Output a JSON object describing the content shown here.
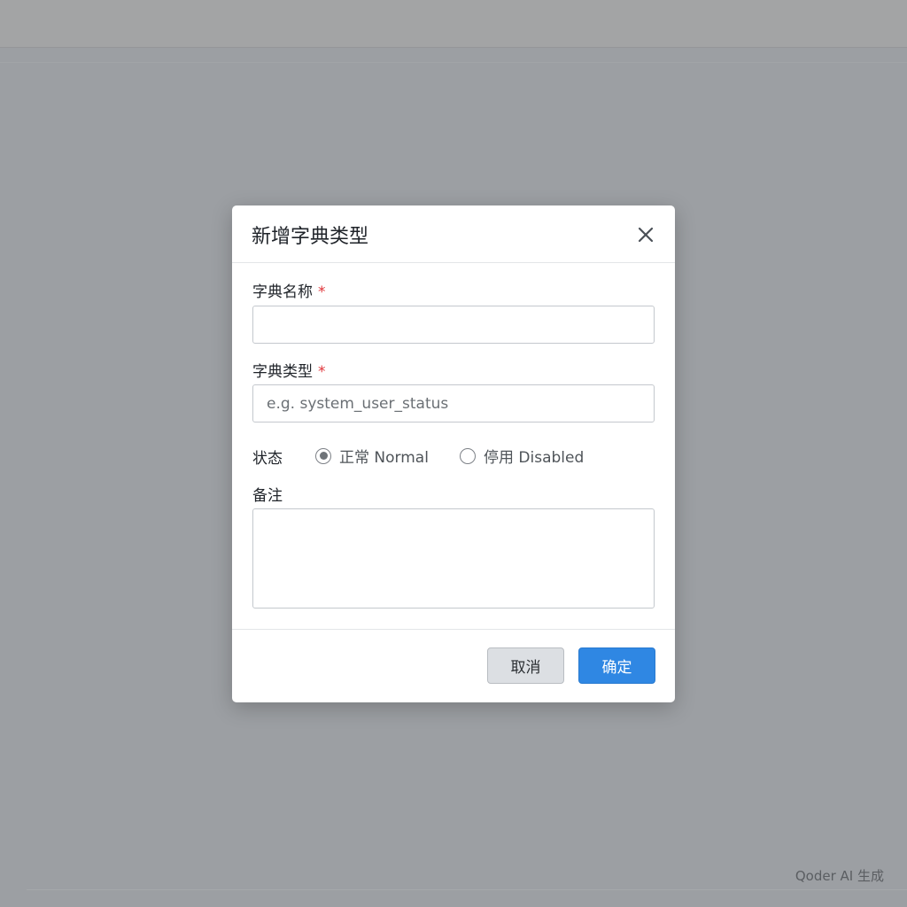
{
  "dialog": {
    "title": "新增字典类型",
    "close_icon": "close-icon",
    "fields": {
      "dict_name": {
        "label": "字典名称",
        "required_mark": "*",
        "value": "",
        "placeholder": ""
      },
      "dict_type": {
        "label": "字典类型",
        "required_mark": "*",
        "value": "",
        "placeholder": "e.g. system_user_status"
      },
      "status": {
        "label": "状态",
        "options": [
          {
            "label": "正常 Normal",
            "selected": true
          },
          {
            "label": "停用 Disabled",
            "selected": false
          }
        ]
      },
      "remark": {
        "label": "备注",
        "value": ""
      }
    },
    "buttons": {
      "cancel": "取消",
      "confirm": "确定"
    }
  },
  "watermark": "Qoder AI 生成",
  "colors": {
    "overlay": "#9c9fa3",
    "primary": "#2f87e3",
    "required": "#e0353a",
    "cancel_bg": "#dcdfe3"
  }
}
